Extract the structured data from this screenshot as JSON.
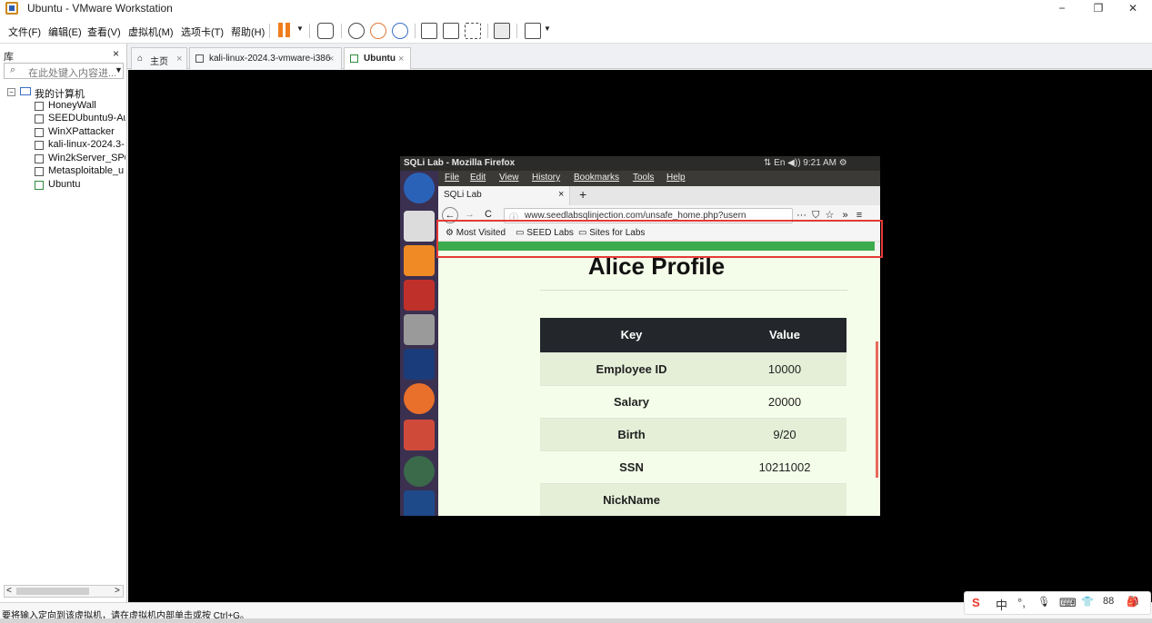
{
  "window": {
    "title": "Ubuntu - VMware Workstation",
    "controls": [
      "−",
      "❐",
      "✕"
    ]
  },
  "menubar": {
    "items": [
      "文件(F)",
      "编辑(E)",
      "查看(V)",
      "虚拟机(M)",
      "选项卡(T)",
      "帮助(H)"
    ]
  },
  "library": {
    "title": "库",
    "close": "×",
    "search_placeholder": "在此处键入内容进...",
    "root": "我的计算机",
    "vms": [
      "HoneyWall",
      "SEEDUbuntu9-Au",
      "WinXPattacker",
      "kali-linux-2024.3-",
      "Win2kServer_SP0",
      "Metasploitable_u",
      "Ubuntu"
    ],
    "scroll_left": "<",
    "scroll_right": ">"
  },
  "tabs": [
    {
      "label": "主页",
      "close": "×"
    },
    {
      "label": "kali-linux-2024.3-vmware-i386",
      "close": "×"
    },
    {
      "label": "Ubuntu",
      "close": "×"
    }
  ],
  "guest": {
    "title": "SQLi Lab - Mozilla Firefox",
    "status": "⇅  En  ◀))  9:21 AM  ⚙",
    "firefox": {
      "menu": [
        "File",
        "Edit",
        "View",
        "History",
        "Bookmarks",
        "Tools",
        "Help"
      ],
      "tab_label": "SQLi Lab",
      "tab_close": "×",
      "new_tab": "+",
      "url": "www.seedlabsqlinjection.com/unsafe_home.php?usern",
      "nav_icons": [
        "←",
        "→",
        "C"
      ],
      "right_icons": "···  ⛉  ☆   »   ≡",
      "bookmarks": [
        "Most Visited",
        "SEED Labs",
        "Sites for Labs"
      ]
    },
    "page": {
      "heading": "Alice Profile",
      "table_headers": [
        "Key",
        "Value"
      ],
      "rows": [
        {
          "key": "Employee ID",
          "value": "10000"
        },
        {
          "key": "Salary",
          "value": "20000"
        },
        {
          "key": "Birth",
          "value": "9/20"
        },
        {
          "key": "SSN",
          "value": "10211002"
        },
        {
          "key": "NickName",
          "value": ""
        }
      ]
    }
  },
  "statusbar": {
    "text": "要将输入定向到该虚拟机，请在虚拟机内部单击或按 Ctrl+G。"
  },
  "ime": {
    "items": [
      "S",
      "中",
      "°,",
      "🎙",
      "⌨",
      "👕",
      "88",
      "🎒"
    ]
  },
  "colors": {
    "accent_pause": "#f07d1d",
    "highlight_box": "#e53935",
    "progress_bar": "#3cab4e",
    "launcher_bg": "#3b3050"
  }
}
